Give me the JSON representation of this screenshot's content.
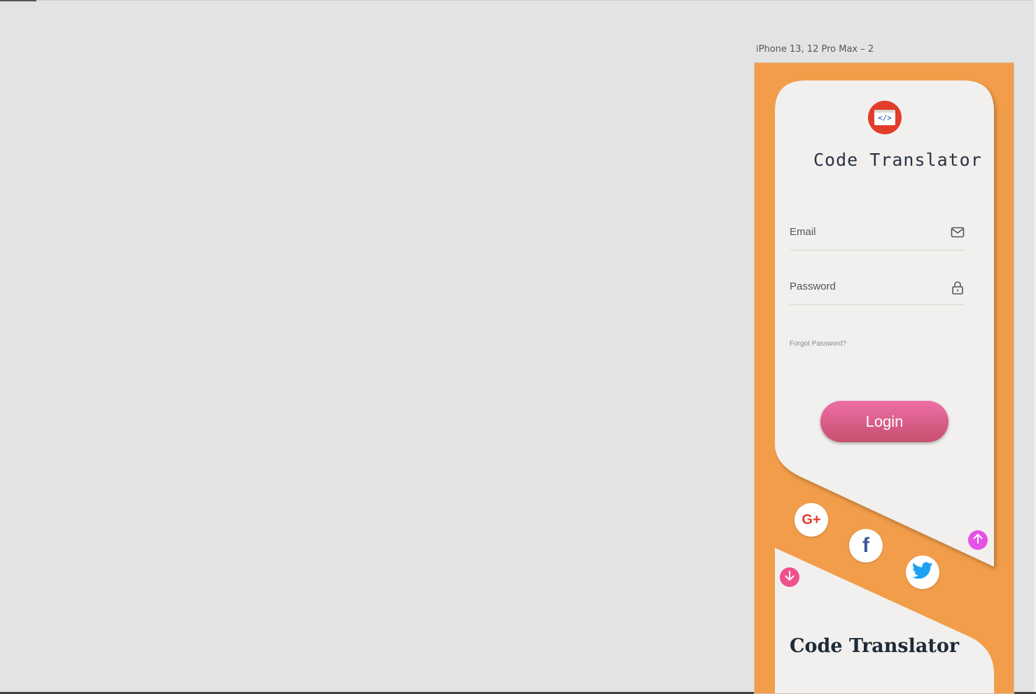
{
  "canvas": {
    "artboard_label": "iPhone 13, 12 Pro Max – 2"
  },
  "login_card": {
    "logo_glyph": "</>",
    "title": "Code Translator",
    "email_label": "Email",
    "password_label": "Password",
    "forgot_label": "Forgot Password?",
    "login_label": "Login"
  },
  "social": {
    "google_label": "G+",
    "facebook_label": "f"
  },
  "signup_card": {
    "title": "Code Translator"
  },
  "colors": {
    "artboard_bg": "#f29d4a",
    "card_bg": "#f1f0ee",
    "login_gradient_top": "#ee6fa8",
    "login_gradient_bottom": "#c64f6d",
    "google": "#e23d2b",
    "facebook": "#3b5998",
    "twitter": "#1da1f2",
    "arrow_up": "#e651e6",
    "arrow_down": "#f0508e"
  },
  "icons": [
    "envelope-icon",
    "lock-icon",
    "google-plus-icon",
    "facebook-icon",
    "twitter-icon",
    "arrow-up-icon",
    "arrow-down-icon"
  ]
}
